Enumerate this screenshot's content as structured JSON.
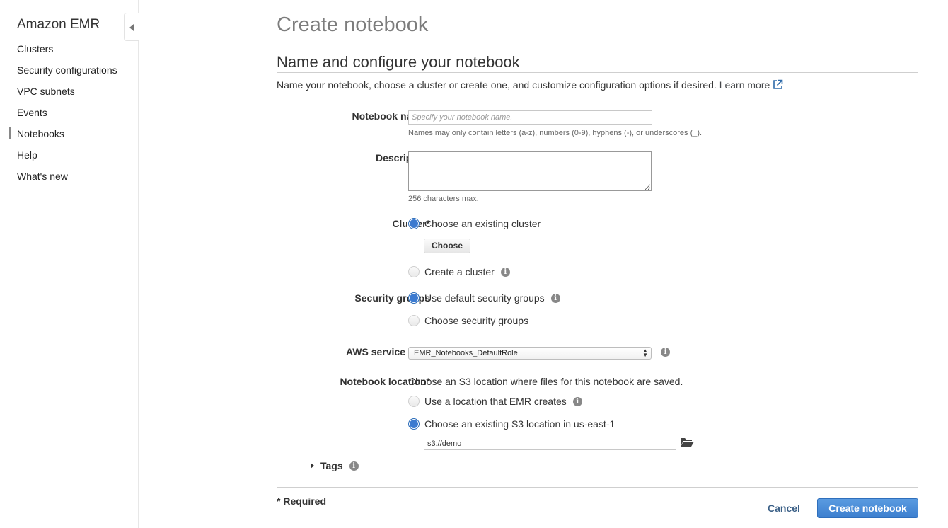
{
  "sidebar": {
    "brand": "Amazon EMR",
    "items": [
      {
        "label": "Clusters"
      },
      {
        "label": "Security configurations"
      },
      {
        "label": "VPC subnets"
      },
      {
        "label": "Events"
      },
      {
        "label": "Notebooks"
      },
      {
        "label": "Help"
      },
      {
        "label": "What's new"
      }
    ],
    "active_item": "Notebooks"
  },
  "page": {
    "title": "Create notebook",
    "section_title": "Name and configure your notebook",
    "intro": "Name your notebook, choose a cluster or create one, and customize configuration options if desired.",
    "learn_more": "Learn more"
  },
  "form": {
    "notebook_name": {
      "label": "Notebook name*",
      "value": "",
      "placeholder": "Specify your notebook name.",
      "hint": "Names may only contain letters (a-z), numbers (0-9), hyphens (-), or underscores (_)."
    },
    "description": {
      "label": "Description",
      "value": "",
      "hint": "256 characters max."
    },
    "cluster": {
      "label": "Cluster*",
      "option_existing": "Choose an existing cluster",
      "choose_button": "Choose",
      "option_create": "Create a cluster",
      "selected": "existing"
    },
    "security_groups": {
      "label": "Security groups",
      "option_default": "Use default security groups",
      "option_choose": "Choose security groups",
      "selected": "default"
    },
    "service_role": {
      "label": "AWS service role*",
      "selected": "EMR_Notebooks_DefaultRole"
    },
    "location": {
      "label": "Notebook location*",
      "description": "Choose an S3 location where files for this notebook are saved.",
      "option_emr": "Use a location that EMR creates",
      "option_existing": "Choose an existing S3 location in us-east-1",
      "path_value": "s3://demo",
      "selected": "existing"
    },
    "tags_label": "Tags"
  },
  "footer": {
    "required_note": "* Required",
    "cancel_label": "Cancel",
    "submit_label": "Create notebook"
  },
  "colors": {
    "primary_button": "#3d7fcf",
    "link": "#3a5f86",
    "radio_selected": "#3b7ad0"
  }
}
